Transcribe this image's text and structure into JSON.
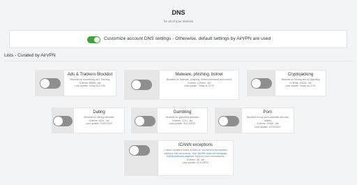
{
  "page": {
    "title": "DNS",
    "subtitle": "for all of your devices"
  },
  "global_setting": {
    "label": "Customize account DNS settings - Otherwise, default settings by AirVPN are used",
    "enabled": true,
    "toggle_color": "#3fa33a"
  },
  "lists": {
    "heading": "Lists - Curated by AirVPN",
    "items": [
      {
        "name": "Ads & Trackers Blocklist",
        "desc": "Blocklist for Advertising and Tracking",
        "items": "N.items: 95688 - list",
        "updated": "Last update: Today at 12:35",
        "enabled": false
      },
      {
        "name": "Malware, phishing, botnet",
        "desc": "Blocklist for Malware, phishing, botnet command and control",
        "items": "N.items: 125345 - list",
        "updated": "Last update: Today at 12:37",
        "enabled": false
      },
      {
        "name": "Cryptojacking",
        "desc": "Blocklist for Mining site by hijacking",
        "items": "N.items: 10628 - list",
        "updated": "Last update: Today at 12:31",
        "enabled": false
      },
      {
        "name": "Dating",
        "desc": "Blocklist for dating websites",
        "items": "N.items: 2620 - list",
        "updated": "Last update: 01/02/2023",
        "enabled": false
      },
      {
        "name": "Gambling",
        "desc": "Blocklist for gambling websites",
        "items": "N.items: 2710 - list",
        "updated": "Last update: 01/12/2022",
        "enabled": false
      },
      {
        "name": "Porn",
        "desc": "Blocklist for top porn websites and ads related",
        "items": "N.items: 12665 - list",
        "updated": "Last update: 12/10/2021",
        "enabled": false
      },
      {
        "name": "ICANN exceptions",
        "desc": "Custom answers where ICANN or root servers themselves interfere with censorship. See",
        "desc_link": "'AirVPN does not recognize ICANN authority anymore'",
        "desc_tail": "topic for more informations.",
        "items": "N.items: 38 - list",
        "updated": "Last update: 21/10/2021",
        "enabled": false
      }
    ]
  },
  "colors": {
    "background": "#f3f4f5",
    "card": "#ffffff",
    "toggle_off": "#8e8e8e",
    "toggle_on": "#3fa33a",
    "link": "#2a7ab5"
  }
}
